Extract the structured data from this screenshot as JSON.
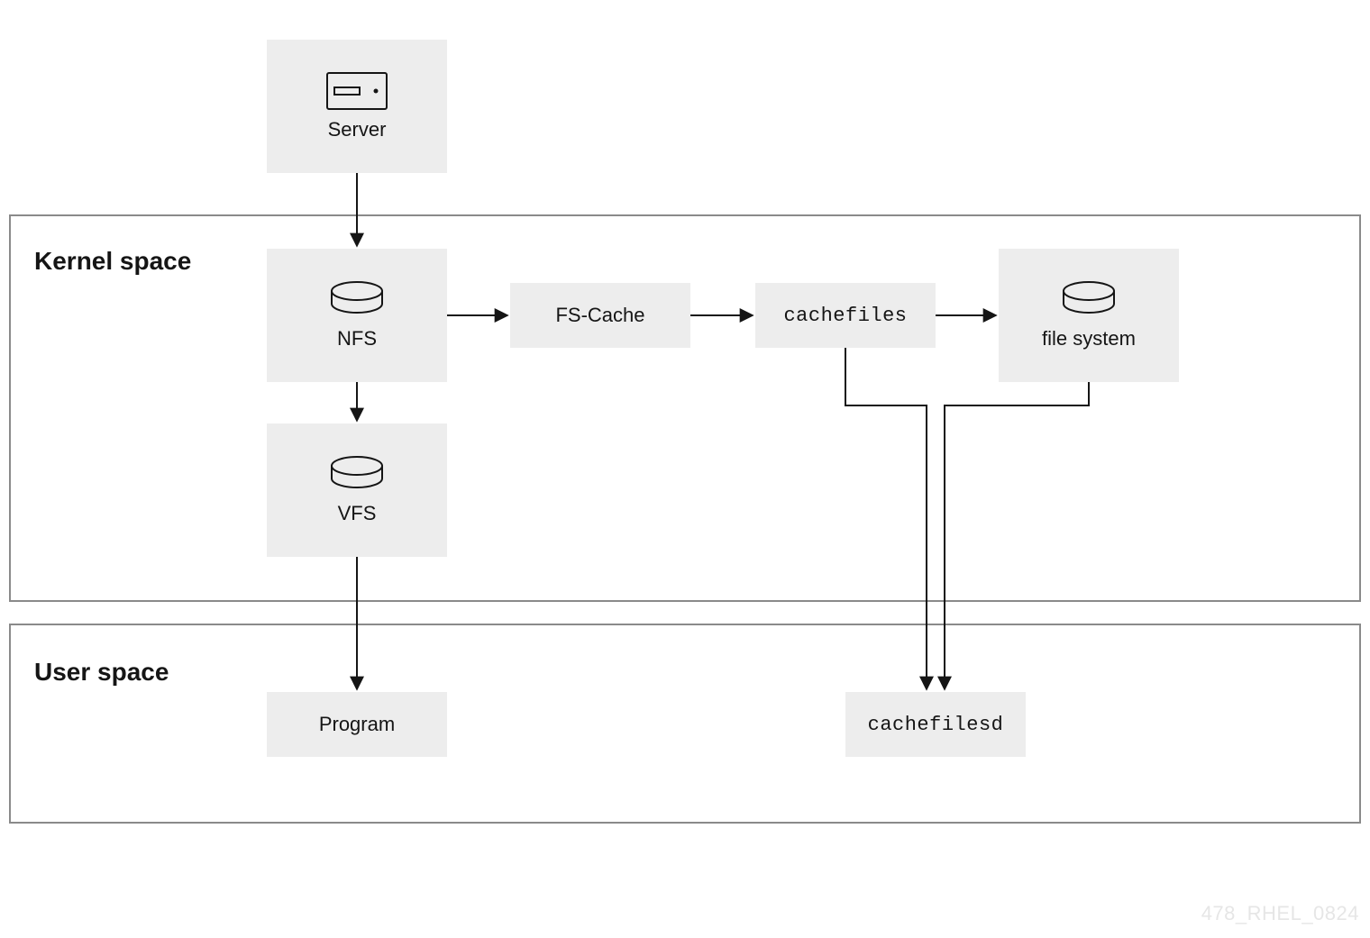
{
  "nodes": {
    "server": {
      "label": "Server"
    },
    "nfs": {
      "label": "NFS"
    },
    "fscache": {
      "label": "FS-Cache"
    },
    "cachefiles": {
      "label": "cachefiles"
    },
    "filesystem": {
      "label": "file system"
    },
    "vfs": {
      "label": "VFS"
    },
    "program": {
      "label": "Program"
    },
    "cachefilesd": {
      "label": "cachefilesd"
    }
  },
  "regions": {
    "kernel": {
      "title": "Kernel space"
    },
    "user": {
      "title": "User space"
    }
  },
  "watermark": "478_RHEL_0824",
  "colors": {
    "node_bg": "#ededed",
    "border": "#8a8a8a",
    "stroke": "#151515"
  }
}
